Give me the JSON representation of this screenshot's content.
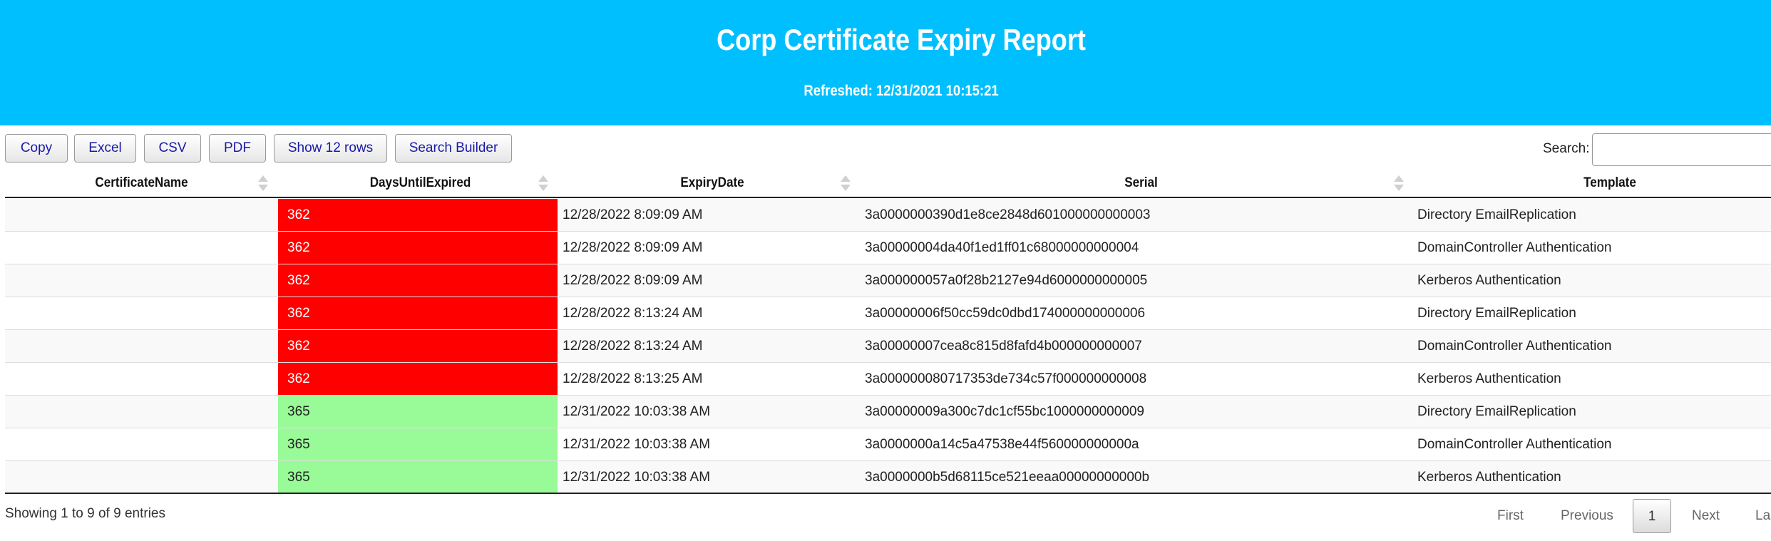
{
  "header": {
    "title": "Corp Certificate Expiry Report",
    "refreshed": "Refreshed: 12/31/2021 10:15:21"
  },
  "toolbar": {
    "buttons": [
      "Copy",
      "Excel",
      "CSV",
      "PDF",
      "Show 12 rows",
      "Search Builder"
    ],
    "search_label": "Search:",
    "search_value": ""
  },
  "table": {
    "columns": [
      "CertificateName",
      "DaysUntilExpired",
      "ExpiryDate",
      "Serial",
      "Template"
    ],
    "rows": [
      {
        "name": "",
        "days": "362",
        "expiry": "12/28/2022 8:09:09 AM",
        "serial": "3a0000000390d1e8ce2848d601000000000003",
        "template": "Directory EmailReplication",
        "status": "red"
      },
      {
        "name": "",
        "days": "362",
        "expiry": "12/28/2022 8:09:09 AM",
        "serial": "3a00000004da40f1ed1ff01c68000000000004",
        "template": "DomainController Authentication",
        "status": "red"
      },
      {
        "name": "",
        "days": "362",
        "expiry": "12/28/2022 8:09:09 AM",
        "serial": "3a000000057a0f28b2127e94d6000000000005",
        "template": "Kerberos Authentication",
        "status": "red"
      },
      {
        "name": "",
        "days": "362",
        "expiry": "12/28/2022 8:13:24 AM",
        "serial": "3a00000006f50cc59dc0dbd174000000000006",
        "template": "Directory EmailReplication",
        "status": "red"
      },
      {
        "name": "",
        "days": "362",
        "expiry": "12/28/2022 8:13:24 AM",
        "serial": "3a00000007cea8c815d8fafd4b000000000007",
        "template": "DomainController Authentication",
        "status": "red"
      },
      {
        "name": "",
        "days": "362",
        "expiry": "12/28/2022 8:13:25 AM",
        "serial": "3a000000080717353de734c57f000000000008",
        "template": "Kerberos Authentication",
        "status": "red"
      },
      {
        "name": "",
        "days": "365",
        "expiry": "12/31/2022 10:03:38 AM",
        "serial": "3a00000009a300c7dc1cf55bc1000000000009",
        "template": "Directory EmailReplication",
        "status": "green"
      },
      {
        "name": "",
        "days": "365",
        "expiry": "12/31/2022 10:03:38 AM",
        "serial": "3a0000000a14c5a47538e44f560000000000a",
        "template": "DomainController Authentication",
        "status": "green"
      },
      {
        "name": "",
        "days": "365",
        "expiry": "12/31/2022 10:03:38 AM",
        "serial": "3a0000000b5d68115ce521eeaa00000000000b",
        "template": "Kerberos Authentication",
        "status": "green"
      }
    ]
  },
  "footer": {
    "info": "Showing 1 to 9 of 9 entries",
    "pagination": {
      "first": "First",
      "previous": "Previous",
      "current": "1",
      "next": "Next",
      "last": "Last"
    }
  },
  "colors": {
    "banner": "#00bfff",
    "expiring_soon": "#ff0000",
    "ok": "#98fb98",
    "button_text": "#1a1aa6"
  }
}
